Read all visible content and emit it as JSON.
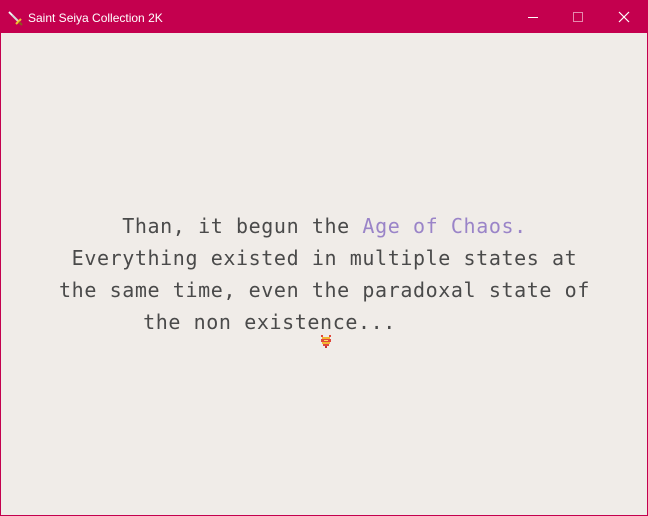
{
  "window": {
    "title": "Saint Seiya Collection 2K",
    "title_bar_color": "#c4004e",
    "app_icon": "sword-icon",
    "controls": [
      "minimize-icon",
      "maximize-icon",
      "close-icon"
    ]
  },
  "dialogue": {
    "line1_pre": "Than, it begun the ",
    "line1_highlight": "Age of Chaos.",
    "line2": "Everything existed in multiple states at",
    "line3": "the same time, even the paradoxal state of",
    "line4": "the non existence...",
    "text_color": "#4a4a4a",
    "highlight_color": "#9a84c8",
    "background_color": "#f0ece8",
    "cursor_icon": "advance-cursor-icon"
  }
}
